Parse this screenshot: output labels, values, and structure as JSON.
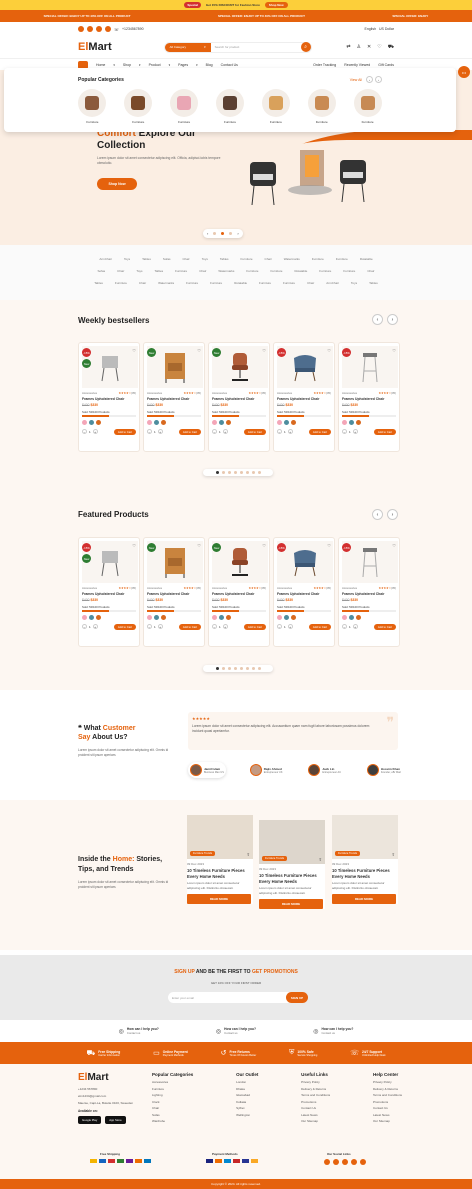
{
  "promo": {
    "tag": "Special",
    "text": "Get 15% DISCOUNT for Fashion Store",
    "button": "Shop Now"
  },
  "ticker": [
    "SPECIAL OFFER: ENJOY UP TO 40% OFF ON ALL PRODUCT",
    "SPECIAL OFFER: ENJOY UP TO 40% OFF ON ALL PRODUCT",
    "SPECIAL OFFER: ENJOY"
  ],
  "topbar": {
    "phone": "+1234567890",
    "language": "English",
    "currency": "US Dollar"
  },
  "header": {
    "logo_a": "El",
    "logo_b": "Mart",
    "category": "All Category",
    "search_placeholder": "Search for product"
  },
  "nav": {
    "items": [
      "Home",
      "Shop",
      "Product",
      "Pages",
      "Blog",
      "Contact Us"
    ],
    "right": [
      "Order Tracking",
      "Recently Viewed",
      "Gift Cards"
    ]
  },
  "popup": {
    "title": "Popular Categories",
    "view_all": "View All",
    "items": [
      "Furniture",
      "Furniture",
      "Furniture",
      "Furniture",
      "Furniture",
      "Furniture",
      "Furniture"
    ]
  },
  "hero": {
    "title_a": "Comfort",
    "title_b": "Explore Our",
    "title_c": "Collection",
    "desc": "Lorem ipsum dolor sit amet consectetur adipiscing elit. Officia, adipisci-tobis tempore obmolutio.",
    "button": "Shop Now"
  },
  "marquee": {
    "words": [
      "ArmChair",
      "Toys",
      "Tables",
      "Sofas",
      "Chair",
      "Toys",
      "Tables",
      "Furniture",
      "Chair",
      "Watermarks",
      "Furniture",
      "Furniture",
      "Rotatable",
      "Furniture",
      "Furniture",
      "Chair"
    ]
  },
  "weekly": {
    "title": "Weekly bestsellers"
  },
  "featured": {
    "title": "Featured Products"
  },
  "product": {
    "category": "Accessories",
    "rating_count": "(05)",
    "name": "Frames Upholstered Chair",
    "old_price": "$400",
    "price": "$330",
    "sold": "Sold: 50/100 Products",
    "add": "Add to Cart",
    "qty": "1"
  },
  "badges": [
    "-15%",
    "New",
    "New",
    "-15%",
    "-15%"
  ],
  "testimonials": {
    "title_a": "What",
    "title_b": "Customer",
    "title_c": "Say",
    "title_d": "About Us?",
    "desc": "Lorem ipsum dolor sit amet consectetur adipiscing elit. Omnis id proident sit ipsum aperiam.",
    "quote": "Lorem ipsum dolor sit amet consectetur adipiscing elit. Accusantium quam nam fugit labore laboriosam possimus dolorem incidunt quasi aperiamfur.",
    "people": [
      {
        "name": "Jamil Islam",
        "role": "Business Man US"
      },
      {
        "name": "Rajiv Ahmed",
        "role": "Entrepreneur UK"
      },
      {
        "name": "Jack Lin",
        "role": "Entrepreneur AU"
      },
      {
        "name": "Hossim Khan",
        "role": "Founder, eBr Mart"
      }
    ]
  },
  "blog": {
    "title_a": "Inside the",
    "title_b": "Home:",
    "title_c": "Stories, Tips, and Trends",
    "desc": "Lorem ipsum dolor sit amet consectetur adipiscing elit. Omnis id proident sit ipsum aperiam.",
    "date": "09 Dec 2023",
    "tag": "Furniture Trends",
    "post": "10 Timeless Furniture Pieces Every Home Needs",
    "excerpt": "Lorem ipsum dolor sit amet consectetur adipiscing elit. Distinctio obcaecati.",
    "read": "READ MORE"
  },
  "newsletter": {
    "title_a": "SIGN UP",
    "title_b": "AND BE THE FIRST TO",
    "title_c": "GET PROMOTIONS",
    "sub": "GET 10% OFF YOUR FIRST ORDER",
    "placeholder": "Enter your email",
    "button": "SIGN UP"
  },
  "help": [
    {
      "title": "How can I help you?",
      "sub": "Contact us"
    },
    {
      "title": "How can I help you?",
      "sub": "Contact us"
    },
    {
      "title": "How can I help you?",
      "sub": "Contact us"
    }
  ],
  "features": [
    {
      "t": "Free Shipping",
      "s": "Carrier Information"
    },
    {
      "t": "Online Payment",
      "s": "Payment Methods"
    },
    {
      "t": "Free Returns",
      "s": "Times Of Favors Better"
    },
    {
      "t": "100% Safe",
      "s": "Secure Shopping"
    },
    {
      "t": "24/7 Support",
      "s": "Unlimited Help Desk"
    }
  ],
  "footer": {
    "logo_a": "El",
    "logo_b": "Mart",
    "phone": "+1234 567890",
    "email": "elm1234@gmail.com",
    "address": "Maerse, Capt-La, Bolette 0100, Sweeden",
    "available": "Available on:",
    "gp": "Google Play",
    "as": "App Store",
    "cols": [
      {
        "title": "Popular Categories",
        "items": [
          "Accessories",
          "Furniture",
          "Lighting",
          "Clock",
          "Chair",
          "Sofas",
          "Wardrobe"
        ]
      },
      {
        "title": "Our Outlet",
        "items": [
          "London",
          "Dhaka",
          "Islamabad",
          "Kolkata",
          "Sylhet",
          "Wellington"
        ]
      },
      {
        "title": "Useful Links",
        "items": [
          "Privacy Policy",
          "Delivery & Returns",
          "Terms and Conditions",
          "Promotions",
          "Contact Us",
          "Latest News",
          "Our Sitemap"
        ]
      },
      {
        "title": "Help Center",
        "items": [
          "Privacy Policy",
          "Delivery & Returns",
          "Terms and Conditions",
          "Promotions",
          "Contact Us",
          "Latest News",
          "Our Sitemap"
        ]
      }
    ],
    "ship": "Free Shipping",
    "pay": "Payment Methods",
    "social": "Our Social Links",
    "copyright": "Copyright © 2024. All rights reserved."
  },
  "colors": {
    "accent": "#e5620d",
    "hero_bg": "#fbeee3"
  }
}
